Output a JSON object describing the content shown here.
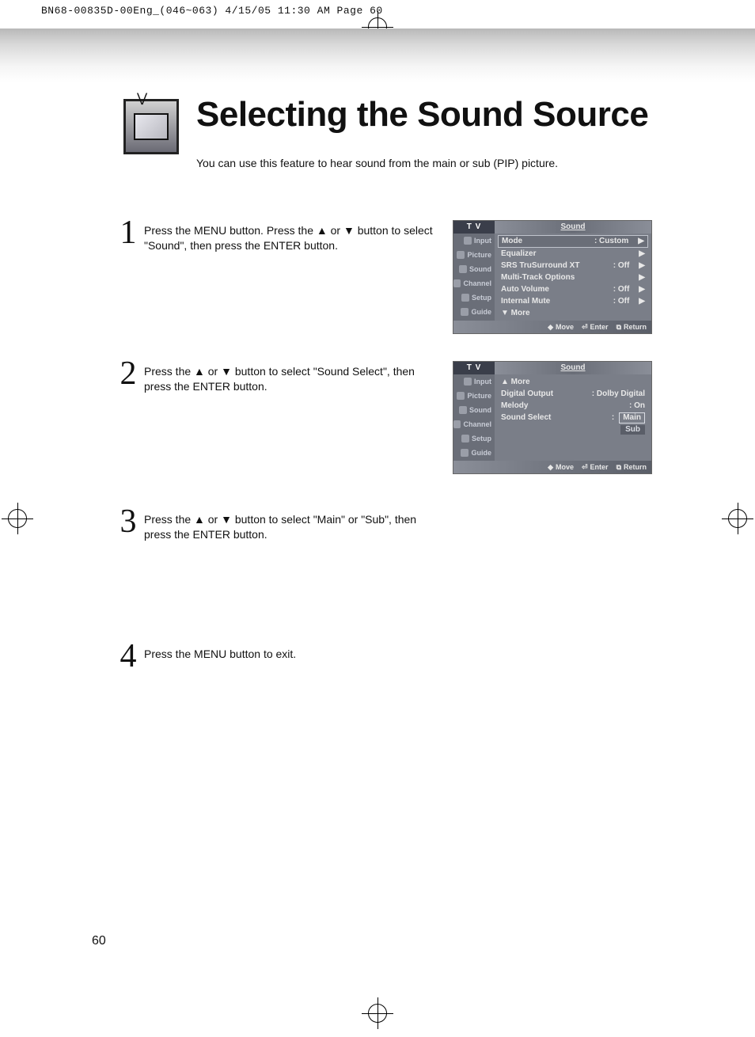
{
  "print_header": "BN68-00835D-00Eng_(046~063)  4/15/05  11:30 AM  Page 60",
  "title": "Selecting the Sound Source",
  "subtitle": "You can use this feature to hear sound from the main or sub (PIP) picture.",
  "steps": [
    {
      "num": "1",
      "text": "Press the MENU button. Press the ▲ or ▼ button to select \"Sound\", then press the ENTER button."
    },
    {
      "num": "2",
      "text": "Press the ▲ or ▼ button to select \"Sound Select\", then press the ENTER button."
    },
    {
      "num": "3",
      "text": "Press the ▲ or ▼ button to select \"Main\" or \"Sub\", then press the ENTER button."
    },
    {
      "num": "4",
      "text": "Press the MENU button to exit."
    }
  ],
  "osd1": {
    "tv": "T V",
    "title": "Sound",
    "side": [
      "Input",
      "Picture",
      "Sound",
      "Channel",
      "Setup",
      "Guide"
    ],
    "rows": [
      {
        "label": "Mode",
        "value": ": Custom",
        "selected": true,
        "arrow": "▶"
      },
      {
        "label": "Equalizer",
        "value": "",
        "arrow": "▶"
      },
      {
        "label": "SRS TruSurround XT",
        "value": ": Off",
        "arrow": "▶"
      },
      {
        "label": "Multi-Track Options",
        "value": "",
        "arrow": "▶"
      },
      {
        "label": "Auto Volume",
        "value": ": Off",
        "arrow": "▶"
      },
      {
        "label": "Internal Mute",
        "value": ": Off",
        "arrow": "▶"
      },
      {
        "label": "▼ More",
        "value": "",
        "arrow": ""
      }
    ],
    "foot": {
      "move": "Move",
      "enter": "Enter",
      "return": "Return"
    }
  },
  "osd2": {
    "tv": "T V",
    "title": "Sound",
    "side": [
      "Input",
      "Picture",
      "Sound",
      "Channel",
      "Setup",
      "Guide"
    ],
    "rows": [
      {
        "label": "▲ More",
        "value": "",
        "arrow": ""
      },
      {
        "label": "Digital Output",
        "value": ": Dolby Digital",
        "arrow": ""
      },
      {
        "label": "Melody",
        "value": ": On",
        "arrow": ""
      },
      {
        "label": "Sound Select",
        "value": ":",
        "arrow": "",
        "select": "Main",
        "sub": "Sub"
      }
    ],
    "foot": {
      "move": "Move",
      "enter": "Enter",
      "return": "Return"
    }
  },
  "page_number": "60",
  "icons": {
    "updown": "◆",
    "enter": "⏎",
    "return": "⧉"
  }
}
